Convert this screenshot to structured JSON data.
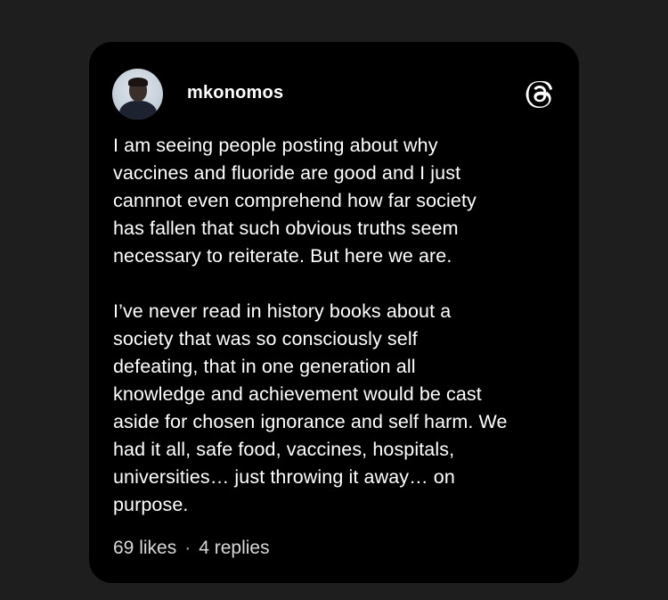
{
  "post": {
    "username": "mkonomos",
    "paragraphs": [
      "I am seeing people posting about why\nvaccines and fluoride are good and I just\ncannnot even comprehend how far society\nhas fallen that such obvious truths seem\nnecessary to reiterate. But here we are.",
      "I’ve never read in history books about a\nsociety that was so consciously self\ndefeating, that in one generation all\nknowledge and achievement would be cast\naside for chosen ignorance and self harm. We\nhad it all, safe food, vaccines, hospitals,\nuniversities… just throwing it away… on\npurpose."
    ],
    "likes": "69 likes",
    "separator": "·",
    "replies": "4 replies"
  },
  "icons": {
    "avatar": "avatar",
    "brand": "threads-icon"
  },
  "colors": {
    "background": "#1e1e1e",
    "card": "#000000",
    "text": "#ffffff"
  }
}
